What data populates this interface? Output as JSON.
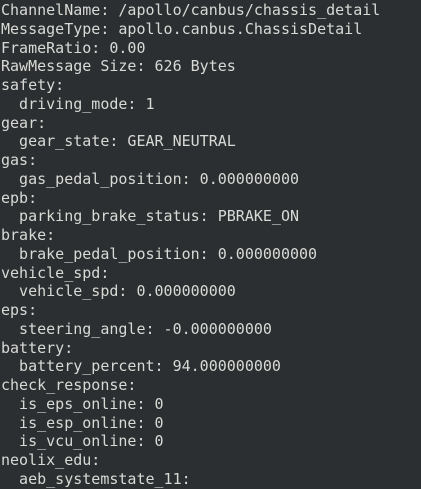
{
  "colors": {
    "background": "#2c2f31",
    "text": "#d8dad6"
  },
  "terminal": {
    "lines": [
      "ChannelName: /apollo/canbus/chassis_detail",
      "MessageType: apollo.canbus.ChassisDetail",
      "FrameRatio: 0.00",
      "RawMessage Size: 626 Bytes",
      "safety:",
      "  driving_mode: 1",
      "gear:",
      "  gear_state: GEAR_NEUTRAL",
      "gas:",
      "  gas_pedal_position: 0.000000000",
      "epb:",
      "  parking_brake_status: PBRAKE_ON",
      "brake:",
      "  brake_pedal_position: 0.000000000",
      "vehicle_spd:",
      "  vehicle_spd: 0.000000000",
      "eps:",
      "  steering_angle: -0.000000000",
      "battery:",
      "  battery_percent: 94.000000000",
      "check_response:",
      "  is_eps_online: 0",
      "  is_esp_online: 0",
      "  is_vcu_online: 0",
      "neolix_edu:",
      "  aeb_systemstate_11:"
    ]
  }
}
